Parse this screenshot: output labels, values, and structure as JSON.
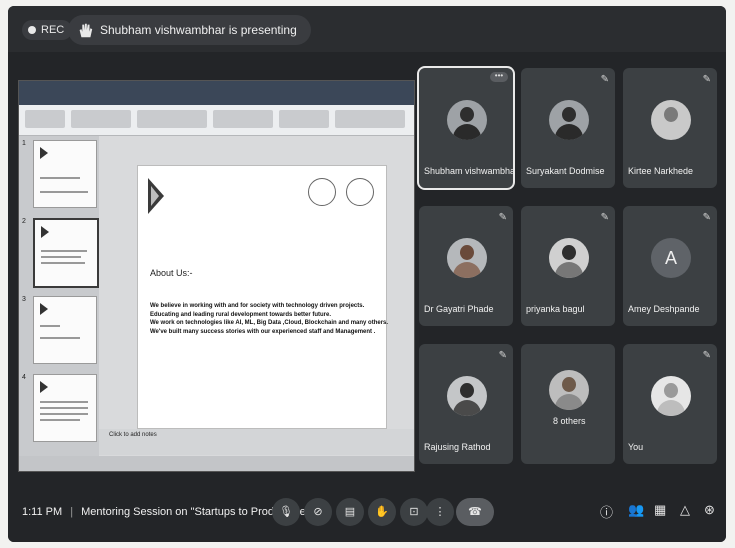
{
  "topbar": {
    "rec_label": "REC",
    "presenting_text": "Shubham vishwambhar is presenting"
  },
  "slide": {
    "heading": "About Us:-",
    "lines": [
      "We believe in working with and for society with technology driven projects.",
      "Educating and leading rural development towards better future.",
      "We work on technologies like AI, ML, Big Data ,Cloud, Blockchain and many others.",
      "We've built many success stories with our experienced staff and Management ."
    ],
    "notes_label": "Click to add notes",
    "thumb_numbers": [
      "1",
      "2",
      "3",
      "4"
    ]
  },
  "participants": [
    {
      "name": "Shubham vishwambhar",
      "active": true
    },
    {
      "name": "Suryakant Dodmise"
    },
    {
      "name": "Kirtee Narkhede"
    },
    {
      "name": "Dr Gayatri Phade"
    },
    {
      "name": "priyanka bagul"
    },
    {
      "name": "Amey Deshpande",
      "initial": "A"
    },
    {
      "name": "Rajusing Rathod"
    },
    {
      "name": "8 others"
    },
    {
      "name": "You"
    }
  ],
  "bottom": {
    "time": "1:11 PM",
    "meeting_title": "Mentoring Session on \"Startups to Product De...",
    "separator": "|"
  }
}
